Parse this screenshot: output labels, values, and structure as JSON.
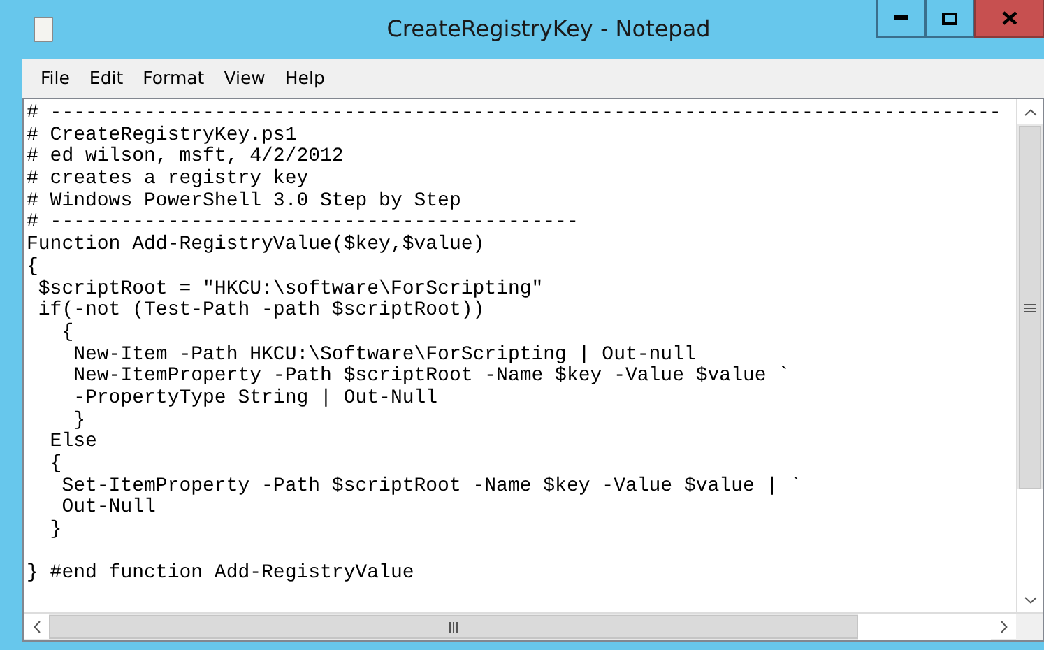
{
  "window": {
    "title": "CreateRegistryKey - Notepad"
  },
  "menu": [
    "File",
    "Edit",
    "Format",
    "View",
    "Help"
  ],
  "code_blocks": [
    [
      "# ---------------------------------------------------------------------------------",
      "# CreateRegistryKey.ps1",
      "# ed wilson, msft, 4/2/2012",
      "# creates a registry key",
      "# Windows PowerShell 3.0 Step by Step",
      "# ---------------------------------------------",
      "Function Add-RegistryValue($key,$value)",
      "{",
      " $scriptRoot = \"HKCU:\\software\\ForScripting\"",
      " if(-not (Test-Path -path $scriptRoot))",
      "   {",
      "    New-Item -Path HKCU:\\Software\\ForScripting | Out-null",
      "    New-ItemProperty -Path $scriptRoot -Name $key -Value $value `",
      "    -PropertyType String | Out-Null",
      "    }",
      "  Else",
      "  {",
      "   Set-ItemProperty -Path $scriptRoot -Name $key -Value $value | `",
      "   Out-Null",
      "  }"
    ],
    [
      "} #end function Add-RegistryValue"
    ]
  ]
}
